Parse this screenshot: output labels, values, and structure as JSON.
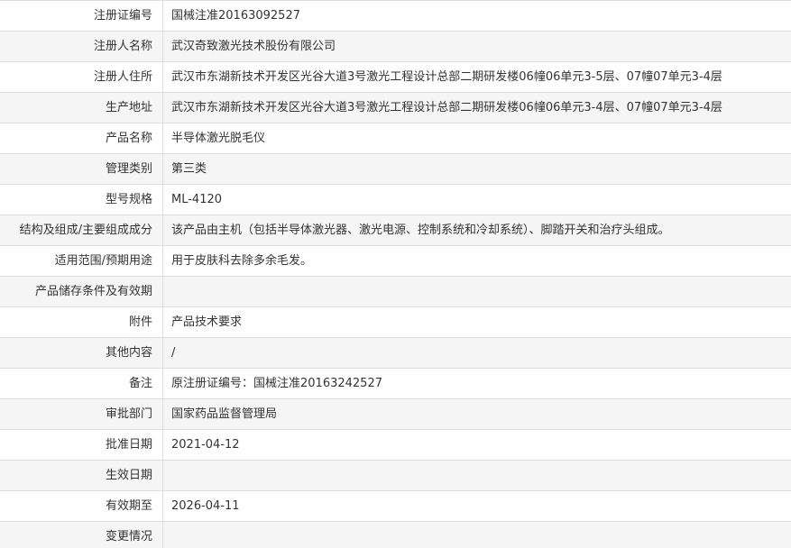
{
  "record": {
    "rows": [
      {
        "label": "注册证编号",
        "value": "国械注准20163092527"
      },
      {
        "label": "注册人名称",
        "value": "武汉奇致激光技术股份有限公司"
      },
      {
        "label": "注册人住所",
        "value": "武汉市东湖新技术开发区光谷大道3号激光工程设计总部二期研发楼06幢06单元3-5层、07幢07单元3-4层"
      },
      {
        "label": "生产地址",
        "value": "武汉市东湖新技术开发区光谷大道3号激光工程设计总部二期研发楼06幢06单元3-4层、07幢07单元3-4层"
      },
      {
        "label": "产品名称",
        "value": "半导体激光脱毛仪"
      },
      {
        "label": "管理类别",
        "value": "第三类"
      },
      {
        "label": "型号规格",
        "value": "ML-4120"
      },
      {
        "label": "结构及组成/主要组成成分",
        "value": "该产品由主机（包括半导体激光器、激光电源、控制系统和冷却系统）、脚踏开关和治疗头组成。"
      },
      {
        "label": "适用范围/预期用途",
        "value": "用于皮肤科去除多余毛发。"
      },
      {
        "label": "产品储存条件及有效期",
        "value": ""
      },
      {
        "label": "附件",
        "value": "产品技术要求"
      },
      {
        "label": "其他内容",
        "value": "/"
      },
      {
        "label": "备注",
        "value": "原注册证编号：国械注准20163242527"
      },
      {
        "label": "审批部门",
        "value": "国家药品监督管理局"
      },
      {
        "label": "批准日期",
        "value": "2021-04-12"
      },
      {
        "label": "生效日期",
        "value": ""
      },
      {
        "label": "有效期至",
        "value": "2026-04-11"
      },
      {
        "label": "变更情况",
        "value": ""
      }
    ]
  }
}
